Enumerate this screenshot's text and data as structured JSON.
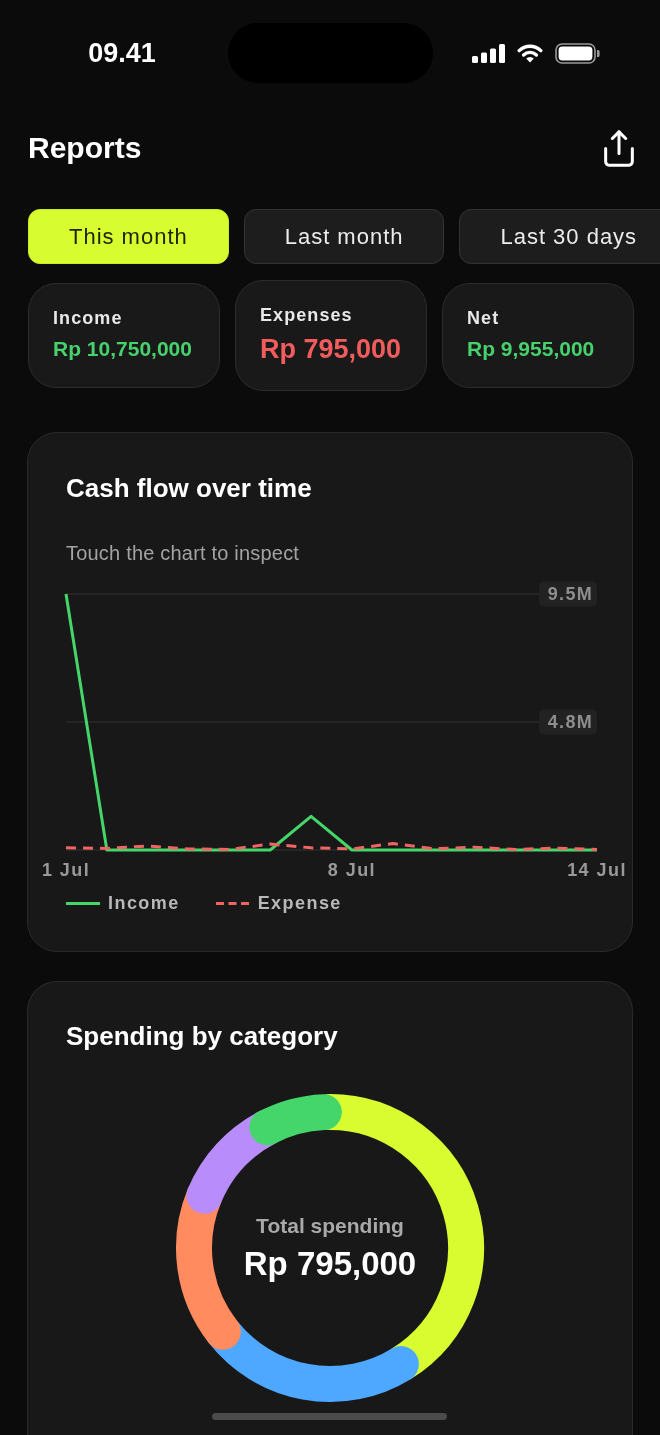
{
  "status_bar": {
    "time": "09.41"
  },
  "header": {
    "title": "Reports"
  },
  "tabs": [
    {
      "label": "This month",
      "selected": true
    },
    {
      "label": "Last month",
      "selected": false
    },
    {
      "label": "Last 30 days",
      "selected": false
    }
  ],
  "summary_cards": [
    {
      "label": "Income",
      "value": "Rp 10,750,000",
      "kind": "positive"
    },
    {
      "label": "Expenses",
      "value": "Rp 795,000",
      "kind": "negative"
    },
    {
      "label": "Net",
      "value": "Rp 9,955,000",
      "kind": "positive"
    }
  ],
  "cash_flow_card": {
    "title": "Cash flow over time",
    "hint": "Touch the chart to inspect",
    "chart_data": {
      "type": "line",
      "categories": [
        "1 Jul",
        null,
        null,
        null,
        null,
        null,
        null,
        "8 Jul",
        null,
        null,
        null,
        null,
        null,
        "14 Jul"
      ],
      "series": [
        {
          "name": "Income",
          "color": "#45d66a",
          "line_style": "solid",
          "values": [
            9500000,
            0,
            0,
            0,
            0,
            0,
            1250000,
            0,
            0,
            0,
            0,
            0,
            0,
            0
          ]
        },
        {
          "name": "Expense",
          "color": "#f06464",
          "line_style": "dashed",
          "values": [
            80000,
            60000,
            150000,
            40000,
            20000,
            220000,
            80000,
            40000,
            240000,
            50000,
            100000,
            20000,
            70000,
            20000
          ]
        }
      ],
      "ylim": [
        0,
        9500000
      ],
      "yticks": [
        {
          "value": 9500000,
          "label": "9.5M"
        },
        {
          "value": 4750000,
          "label": "4.8M"
        }
      ]
    }
  },
  "spending_card": {
    "title": "Spending by category",
    "center_label": "Total spending",
    "center_value": "Rp 795,000"
  }
}
